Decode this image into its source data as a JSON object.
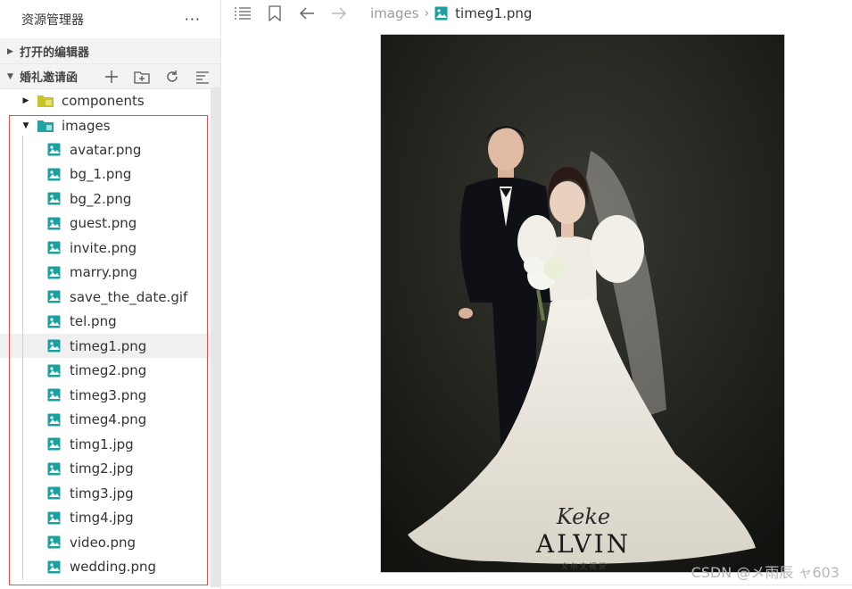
{
  "explorer": {
    "title": "资源管理器",
    "more": "···",
    "open_editors": "打开的编辑器",
    "project": "婚礼邀请函"
  },
  "tree": {
    "components": "components",
    "images": "images",
    "files": [
      "avatar.png",
      "bg_1.png",
      "bg_2.png",
      "guest.png",
      "invite.png",
      "marry.png",
      "save_the_date.gif",
      "tel.png",
      "timeg1.png",
      "timeg2.png",
      "timeg3.png",
      "timeg4.png",
      "timg1.jpg",
      "timg2.jpg",
      "timg3.jpg",
      "timg4.jpg",
      "video.png",
      "wedding.png"
    ],
    "selected": "timeg1.png"
  },
  "editor": {
    "breadcrumb_folder": "images",
    "breadcrumb_file": "timeg1.png",
    "photo_logo_script": "Keke",
    "photo_logo": "ALVIN",
    "photo_logo_sub": "文 尔 文 视 觉"
  },
  "watermark": "CSDN @メ雨辰  ャ603",
  "colors": {
    "accent": "#1aa0a0",
    "folder": "#c8c02a",
    "selection_box": "#d9534f"
  }
}
